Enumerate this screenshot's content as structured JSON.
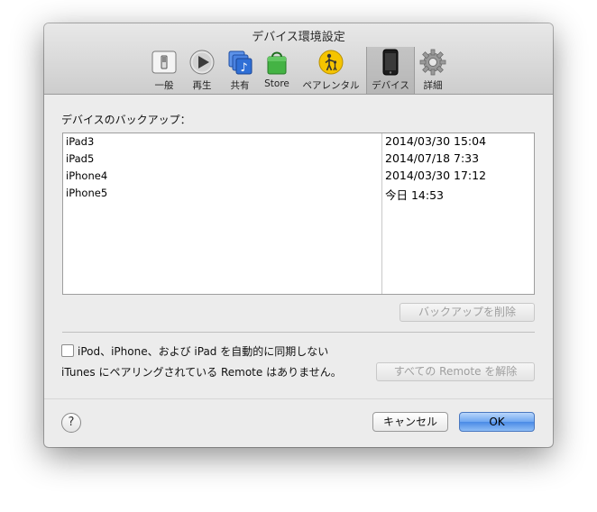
{
  "window": {
    "title": "デバイス環境設定"
  },
  "toolbar": {
    "items": [
      {
        "label": "一般",
        "icon": "general-switch-icon"
      },
      {
        "label": "再生",
        "icon": "play-icon"
      },
      {
        "label": "共有",
        "icon": "sharing-icon"
      },
      {
        "label": "Store",
        "icon": "store-bag-icon"
      },
      {
        "label": "ペアレンタル",
        "icon": "parental-icon"
      },
      {
        "label": "デバイス",
        "icon": "iphone-icon"
      },
      {
        "label": "詳細",
        "icon": "gear-icon"
      }
    ],
    "selected": "デバイス"
  },
  "backups": {
    "section_label": "デバイスのバックアップ：",
    "rows": [
      {
        "name": "iPad3",
        "date": "2014/03/30 15:04"
      },
      {
        "name": "iPad5",
        "date": "2014/07/18 7:33"
      },
      {
        "name": "iPhone4",
        "date": "2014/03/30 17:12"
      },
      {
        "name": "iPhone5",
        "date": "今日 14:53"
      }
    ],
    "delete_button": "バックアップを削除"
  },
  "sync": {
    "checkbox_label": "iPod、iPhone、および iPad を自動的に同期しない",
    "checked": false
  },
  "remote": {
    "status_text": "iTunes にペアリングされている Remote はありません。",
    "unpair_button": "すべての Remote を解除"
  },
  "footer": {
    "help": "?",
    "cancel": "キャンセル",
    "ok": "OK"
  },
  "colors": {
    "window_bg": "#ececec",
    "ok_button": "#6ea7f1",
    "parental_icon": "#f5c400",
    "store_icon": "#3aa63a",
    "share_icon": "#2f6fd6"
  }
}
